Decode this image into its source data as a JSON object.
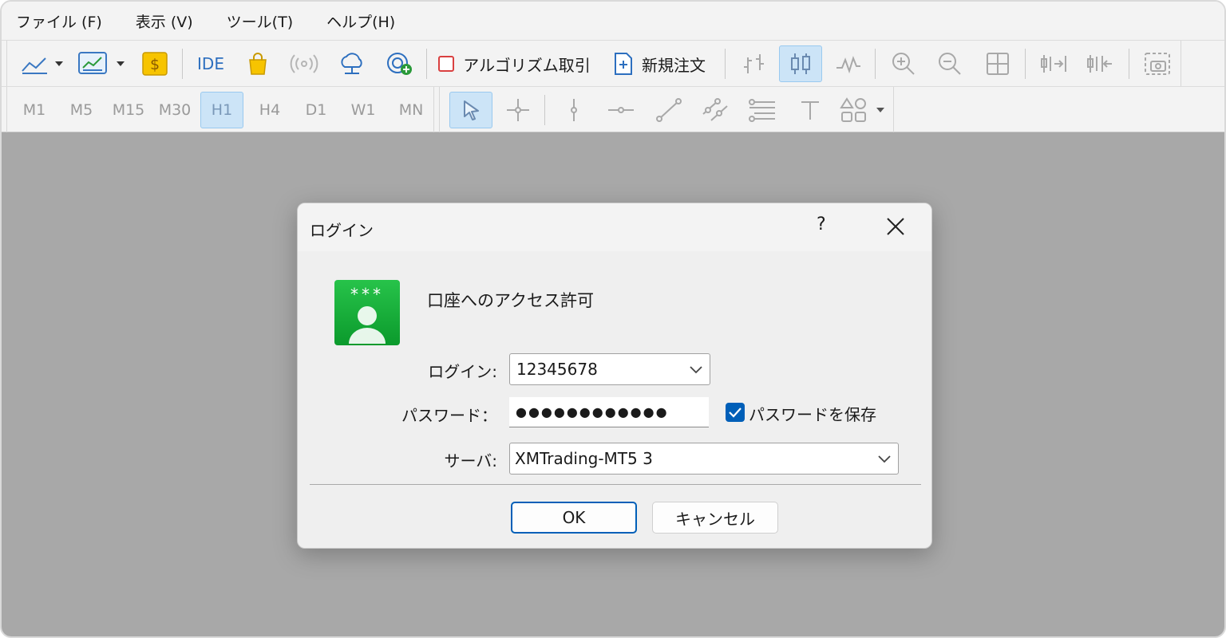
{
  "menu": {
    "items": [
      "ファイル (F)",
      "表示 (V)",
      "ツール(T)",
      "ヘルプ(H)"
    ]
  },
  "toolbar": {
    "ide_label": "IDE",
    "algo_label": "アルゴリズム取引",
    "new_order_label": "新規注文"
  },
  "timeframes": [
    "M1",
    "M5",
    "M15",
    "M30",
    "H1",
    "H4",
    "D1",
    "W1",
    "MN"
  ],
  "timeframes_active": "H1",
  "dialog": {
    "title": "ログイン",
    "help": "?",
    "heading": "口座へのアクセス許可",
    "avatar_stars": "***",
    "login_label": "ログイン:",
    "login_value": "12345678",
    "password_label": "パスワード：",
    "password_value": "●●●●●●●●●●●●",
    "save_password_label": "パスワードを保存",
    "save_password_checked": true,
    "server_label": "サーバ:",
    "server_value": "XMTrading-MT5 3",
    "ok_label": "OK",
    "cancel_label": "キャンセル"
  },
  "colors": {
    "accent": "#005fb8",
    "active_bg": "#cce4f7",
    "workspace": "#a8a8a8",
    "avatar_green": "#0fae35"
  }
}
